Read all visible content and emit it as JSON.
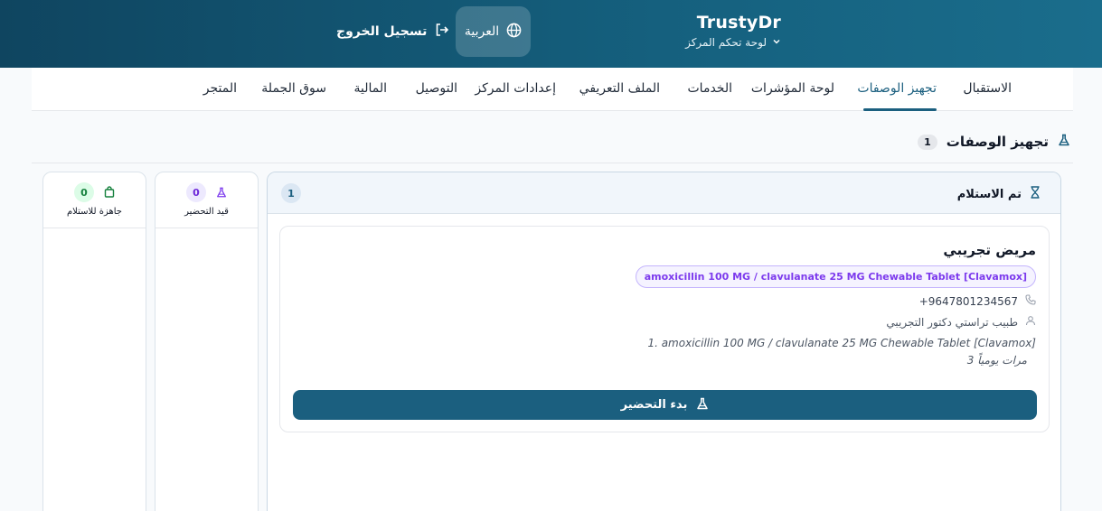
{
  "header": {
    "brand": "TrustyDr",
    "subtitle": "لوحة تحكم المركز",
    "language": "العربية",
    "logout": "تسجيل الخروج"
  },
  "nav": {
    "tabs": [
      {
        "label": "الاستقبال",
        "active": false
      },
      {
        "label": "تجهيز الوصفات",
        "active": true
      },
      {
        "label": "لوحة المؤشرات",
        "active": false
      },
      {
        "label": "الخدمات",
        "active": false
      },
      {
        "label": "الملف التعريفي",
        "active": false
      },
      {
        "label": "إعدادات المركز",
        "active": false
      },
      {
        "label": "التوصيل",
        "active": false
      },
      {
        "label": "المالية",
        "active": false
      },
      {
        "label": "سوق الجملة",
        "active": false
      },
      {
        "label": "المتجر",
        "active": false
      }
    ]
  },
  "section": {
    "title": "تجهيز الوصفات",
    "count": "1"
  },
  "columns": {
    "received": {
      "title": "تم الاستلام",
      "count": "1"
    },
    "preparing": {
      "title": "قيد التحضير",
      "count": "0"
    },
    "ready": {
      "title": "جاهزة للاستلام",
      "count": "0"
    }
  },
  "card": {
    "patient": "مريض تجريبي",
    "drug_badge": "amoxicillin 100 MG / clavulanate 25 MG Chewable Tablet [Clavamox]",
    "phone": "+9647801234567",
    "doctor": "طبيب تراستي دكتور التجريبي",
    "rx_line": "1. amoxicillin 100 MG / clavulanate 25 MG Chewable Tablet [Clavamox]",
    "rx_freq": "3 مرات يومياً",
    "start_button": "بدء التحضير"
  },
  "colors": {
    "header_dark": "#0f4560",
    "primary": "#1b5f7f",
    "badge_purple": "#7c3aed",
    "ready_green": "#15803d"
  }
}
